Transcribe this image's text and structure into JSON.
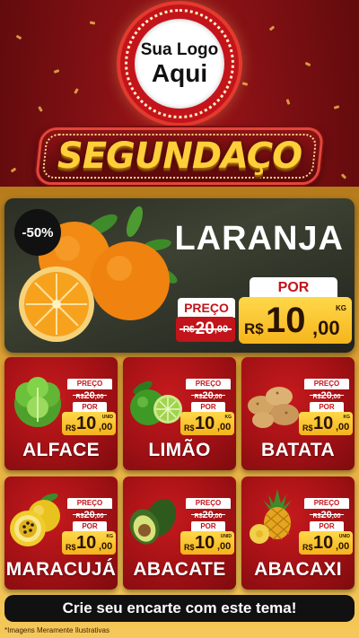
{
  "logo": {
    "line1": "Sua Logo",
    "line2": "Aqui"
  },
  "title": "SEGUNDAÇO",
  "hero": {
    "discount": "-50%",
    "name": "LARANJA",
    "preco_label": "PREÇO",
    "old_currency": "R$",
    "old_int": "20",
    "old_dec": ",00",
    "por_label": "POR",
    "currency": "R$",
    "price_int": "10",
    "price_dec": ",00",
    "unit": "KG"
  },
  "products": [
    {
      "name": "ALFACE",
      "preco_label": "PREÇO",
      "old_currency": "R$",
      "old_int": "20",
      "old_dec": ",00",
      "por_label": "POR",
      "currency": "R$",
      "price_int": "10",
      "price_dec": ",00",
      "unit": "UNID"
    },
    {
      "name": "LIMÃO",
      "preco_label": "PREÇO",
      "old_currency": "R$",
      "old_int": "20",
      "old_dec": ",00",
      "por_label": "POR",
      "currency": "R$",
      "price_int": "10",
      "price_dec": ",00",
      "unit": "KG"
    },
    {
      "name": "BATATA",
      "preco_label": "PREÇO",
      "old_currency": "R$",
      "old_int": "20",
      "old_dec": ",00",
      "por_label": "POR",
      "currency": "R$",
      "price_int": "10",
      "price_dec": ",00",
      "unit": "KG"
    },
    {
      "name": "MARACUJÁ",
      "preco_label": "PREÇO",
      "old_currency": "R$",
      "old_int": "20",
      "old_dec": ",00",
      "por_label": "POR",
      "currency": "R$",
      "price_int": "10",
      "price_dec": ",00",
      "unit": "KG"
    },
    {
      "name": "ABACATE",
      "preco_label": "PREÇO",
      "old_currency": "R$",
      "old_int": "20",
      "old_dec": ",00",
      "por_label": "POR",
      "currency": "R$",
      "price_int": "10",
      "price_dec": ",00",
      "unit": "UNID"
    },
    {
      "name": "ABACAXI",
      "preco_label": "PREÇO",
      "old_currency": "R$",
      "old_int": "20",
      "old_dec": ",00",
      "por_label": "POR",
      "currency": "R$",
      "price_int": "10",
      "price_dec": ",00",
      "unit": "UNID"
    }
  ],
  "cta": "Crie seu encarte com este tema!",
  "disclaimer": "*Imagens Meramente Ilustrativas",
  "colors": {
    "red": "#c2141b",
    "gold": "#f5c85a",
    "dark": "#111111"
  }
}
